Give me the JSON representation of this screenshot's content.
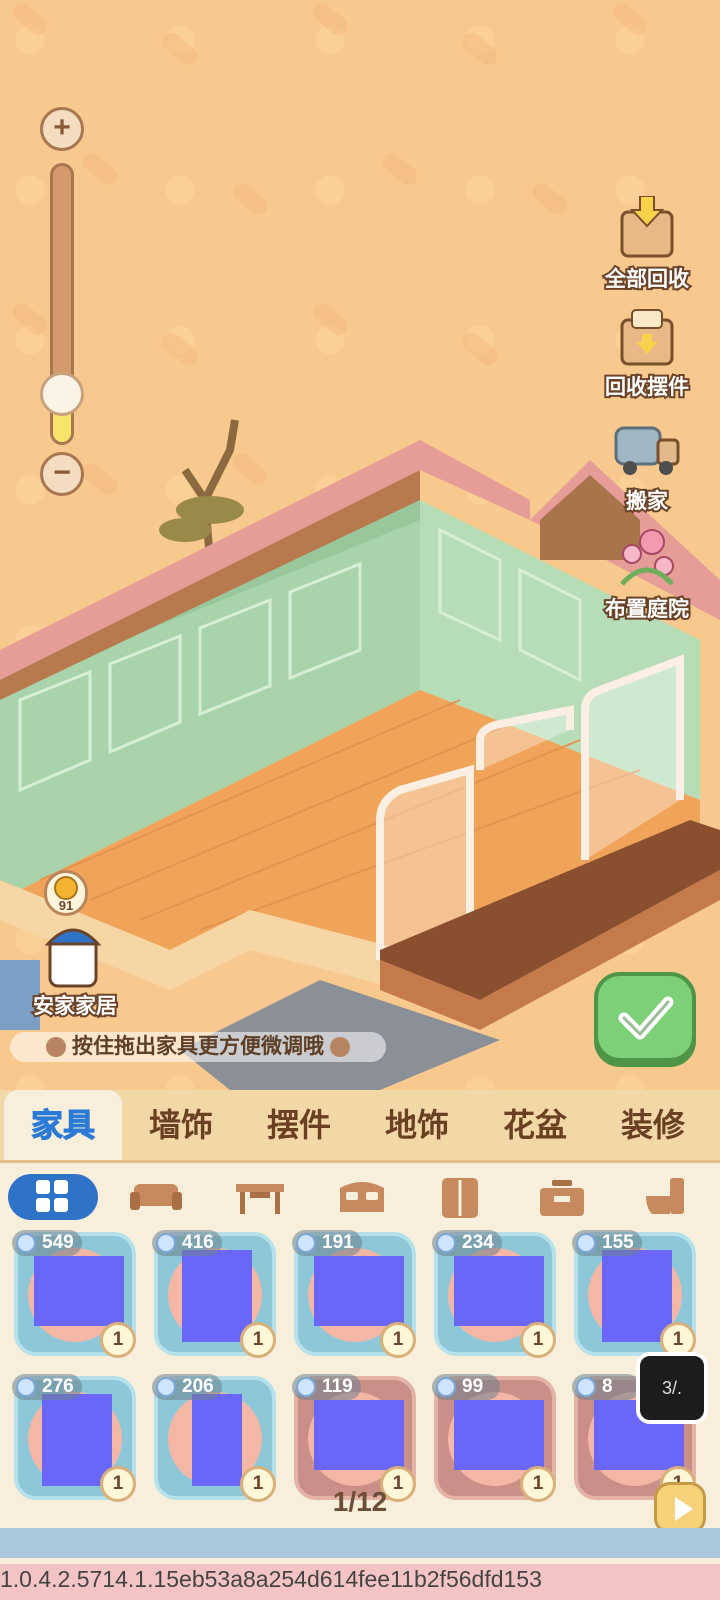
{
  "scene": {
    "zoom_plus": "+",
    "zoom_minus": "−",
    "zoom_level": 0.15,
    "actions": [
      "全部回收",
      "回收摆件",
      "搬家",
      "布置庭院"
    ],
    "npc": {
      "name": "安家家居",
      "coins": "91"
    },
    "hint": "按住拖出家具更方便微调哦"
  },
  "tabs": [
    "家具",
    "墙饰",
    "摆件",
    "地饰",
    "花盆",
    "装修"
  ],
  "sub_icons": [
    "grid-icon",
    "sofa-icon",
    "table-icon",
    "bed-icon",
    "wardrobe-icon",
    "stove-icon",
    "toilet-icon"
  ],
  "items": [
    {
      "price": "549",
      "qty": "1"
    },
    {
      "price": "416",
      "qty": "1"
    },
    {
      "price": "191",
      "qty": "1"
    },
    {
      "price": "234",
      "qty": "1"
    },
    {
      "price": "155",
      "qty": "1"
    },
    {
      "price": "276",
      "qty": "1"
    },
    {
      "price": "206",
      "qty": "1"
    },
    {
      "price": "119",
      "qty": "1"
    },
    {
      "price": "99",
      "qty": "1"
    },
    {
      "price": "8",
      "qty": "1"
    }
  ],
  "pagination": "1/12",
  "float_thumb": "3/.",
  "version": "1.0.4.2.5714.1.15eb53a8a254d614fee11b2f56dfd153",
  "colors": {
    "accent_blue": "#2b7bd6",
    "confirm_green": "#7dcf78",
    "panel_bg": "#f7efdc"
  }
}
